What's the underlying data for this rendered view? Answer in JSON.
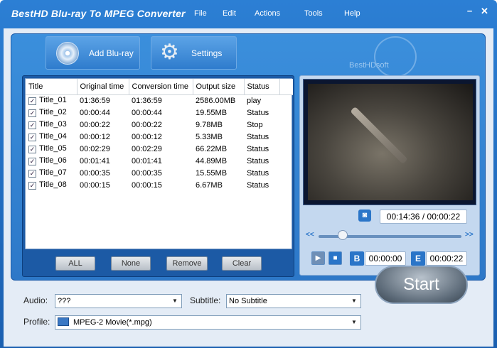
{
  "window": {
    "title": "BestHD Blu-ray To MPEG Converter"
  },
  "menu": [
    {
      "label": "File"
    },
    {
      "label": "Edit"
    },
    {
      "label": "Actions"
    },
    {
      "label": "Tools"
    },
    {
      "label": "Help"
    }
  ],
  "toolbar": {
    "add_bluray_label": "Add Blu-ray",
    "settings_label": "Settings",
    "brand": "BestHDsoft"
  },
  "table": {
    "columns": [
      "Title",
      "Original time",
      "Conversion time",
      "Output size",
      "Status"
    ],
    "rows": [
      {
        "title": "Title_01",
        "original": "01:36:59",
        "conversion": "01:36:59",
        "size": "2586.00MB",
        "status": "play"
      },
      {
        "title": "Title_02",
        "original": "00:00:44",
        "conversion": "00:00:44",
        "size": "19.55MB",
        "status": "Status"
      },
      {
        "title": "Title_03",
        "original": "00:00:22",
        "conversion": "00:00:22",
        "size": "9.78MB",
        "status": "Stop"
      },
      {
        "title": "Title_04",
        "original": "00:00:12",
        "conversion": "00:00:12",
        "size": "5.33MB",
        "status": "Status"
      },
      {
        "title": "Title_05",
        "original": "00:02:29",
        "conversion": "00:02:29",
        "size": "66.22MB",
        "status": "Status"
      },
      {
        "title": "Title_06",
        "original": "00:01:41",
        "conversion": "00:01:41",
        "size": "44.89MB",
        "status": "Status"
      },
      {
        "title": "Title_07",
        "original": "00:00:35",
        "conversion": "00:00:35",
        "size": "15.55MB",
        "status": "Status"
      },
      {
        "title": "Title_08",
        "original": "00:00:15",
        "conversion": "00:00:15",
        "size": "6.67MB",
        "status": "Status"
      }
    ]
  },
  "list_buttons": {
    "all": "ALL",
    "none": "None",
    "remove": "Remove",
    "clear": "Clear"
  },
  "preview": {
    "current_time": "00:14:36",
    "separator": "/",
    "total_time": "00:00:22",
    "seek_position": 0.17,
    "begin_letter": "B",
    "begin_time": "00:00:00",
    "end_letter": "E",
    "end_time": "00:00:22",
    "rewind": "<<",
    "forward": ">>"
  },
  "form": {
    "audio_label": "Audio:",
    "audio_value": "???",
    "subtitle_label": "Subtitle:",
    "subtitle_value": "No Subtitle",
    "profile_label": "Profile:",
    "profile_value": "MPEG-2 Movie(*.mpg)"
  },
  "start_label": "Start"
}
